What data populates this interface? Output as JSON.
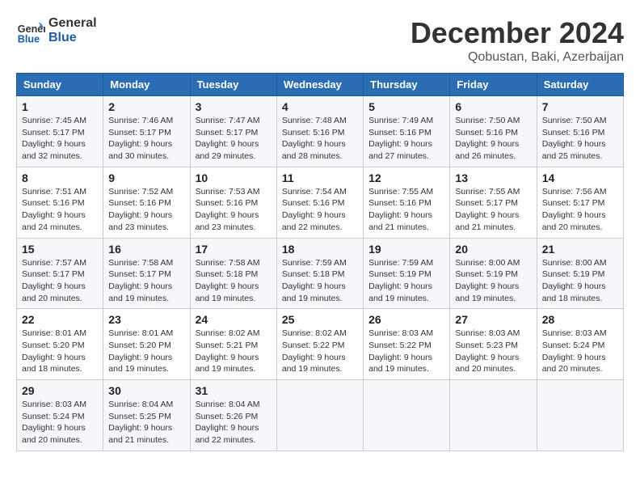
{
  "header": {
    "logo_line1": "General",
    "logo_line2": "Blue",
    "month": "December 2024",
    "location": "Qobustan, Baki, Azerbaijan"
  },
  "weekdays": [
    "Sunday",
    "Monday",
    "Tuesday",
    "Wednesday",
    "Thursday",
    "Friday",
    "Saturday"
  ],
  "weeks": [
    [
      {
        "day": "1",
        "sunrise": "7:45 AM",
        "sunset": "5:17 PM",
        "daylight": "9 hours and 32 minutes."
      },
      {
        "day": "2",
        "sunrise": "7:46 AM",
        "sunset": "5:17 PM",
        "daylight": "9 hours and 30 minutes."
      },
      {
        "day": "3",
        "sunrise": "7:47 AM",
        "sunset": "5:17 PM",
        "daylight": "9 hours and 29 minutes."
      },
      {
        "day": "4",
        "sunrise": "7:48 AM",
        "sunset": "5:16 PM",
        "daylight": "9 hours and 28 minutes."
      },
      {
        "day": "5",
        "sunrise": "7:49 AM",
        "sunset": "5:16 PM",
        "daylight": "9 hours and 27 minutes."
      },
      {
        "day": "6",
        "sunrise": "7:50 AM",
        "sunset": "5:16 PM",
        "daylight": "9 hours and 26 minutes."
      },
      {
        "day": "7",
        "sunrise": "7:50 AM",
        "sunset": "5:16 PM",
        "daylight": "9 hours and 25 minutes."
      }
    ],
    [
      {
        "day": "8",
        "sunrise": "7:51 AM",
        "sunset": "5:16 PM",
        "daylight": "9 hours and 24 minutes."
      },
      {
        "day": "9",
        "sunrise": "7:52 AM",
        "sunset": "5:16 PM",
        "daylight": "9 hours and 23 minutes."
      },
      {
        "day": "10",
        "sunrise": "7:53 AM",
        "sunset": "5:16 PM",
        "daylight": "9 hours and 23 minutes."
      },
      {
        "day": "11",
        "sunrise": "7:54 AM",
        "sunset": "5:16 PM",
        "daylight": "9 hours and 22 minutes."
      },
      {
        "day": "12",
        "sunrise": "7:55 AM",
        "sunset": "5:16 PM",
        "daylight": "9 hours and 21 minutes."
      },
      {
        "day": "13",
        "sunrise": "7:55 AM",
        "sunset": "5:17 PM",
        "daylight": "9 hours and 21 minutes."
      },
      {
        "day": "14",
        "sunrise": "7:56 AM",
        "sunset": "5:17 PM",
        "daylight": "9 hours and 20 minutes."
      }
    ],
    [
      {
        "day": "15",
        "sunrise": "7:57 AM",
        "sunset": "5:17 PM",
        "daylight": "9 hours and 20 minutes."
      },
      {
        "day": "16",
        "sunrise": "7:58 AM",
        "sunset": "5:17 PM",
        "daylight": "9 hours and 19 minutes."
      },
      {
        "day": "17",
        "sunrise": "7:58 AM",
        "sunset": "5:18 PM",
        "daylight": "9 hours and 19 minutes."
      },
      {
        "day": "18",
        "sunrise": "7:59 AM",
        "sunset": "5:18 PM",
        "daylight": "9 hours and 19 minutes."
      },
      {
        "day": "19",
        "sunrise": "7:59 AM",
        "sunset": "5:19 PM",
        "daylight": "9 hours and 19 minutes."
      },
      {
        "day": "20",
        "sunrise": "8:00 AM",
        "sunset": "5:19 PM",
        "daylight": "9 hours and 19 minutes."
      },
      {
        "day": "21",
        "sunrise": "8:00 AM",
        "sunset": "5:19 PM",
        "daylight": "9 hours and 18 minutes."
      }
    ],
    [
      {
        "day": "22",
        "sunrise": "8:01 AM",
        "sunset": "5:20 PM",
        "daylight": "9 hours and 18 minutes."
      },
      {
        "day": "23",
        "sunrise": "8:01 AM",
        "sunset": "5:20 PM",
        "daylight": "9 hours and 19 minutes."
      },
      {
        "day": "24",
        "sunrise": "8:02 AM",
        "sunset": "5:21 PM",
        "daylight": "9 hours and 19 minutes."
      },
      {
        "day": "25",
        "sunrise": "8:02 AM",
        "sunset": "5:22 PM",
        "daylight": "9 hours and 19 minutes."
      },
      {
        "day": "26",
        "sunrise": "8:03 AM",
        "sunset": "5:22 PM",
        "daylight": "9 hours and 19 minutes."
      },
      {
        "day": "27",
        "sunrise": "8:03 AM",
        "sunset": "5:23 PM",
        "daylight": "9 hours and 20 minutes."
      },
      {
        "day": "28",
        "sunrise": "8:03 AM",
        "sunset": "5:24 PM",
        "daylight": "9 hours and 20 minutes."
      }
    ],
    [
      {
        "day": "29",
        "sunrise": "8:03 AM",
        "sunset": "5:24 PM",
        "daylight": "9 hours and 20 minutes."
      },
      {
        "day": "30",
        "sunrise": "8:04 AM",
        "sunset": "5:25 PM",
        "daylight": "9 hours and 21 minutes."
      },
      {
        "day": "31",
        "sunrise": "8:04 AM",
        "sunset": "5:26 PM",
        "daylight": "9 hours and 22 minutes."
      },
      null,
      null,
      null,
      null
    ]
  ]
}
